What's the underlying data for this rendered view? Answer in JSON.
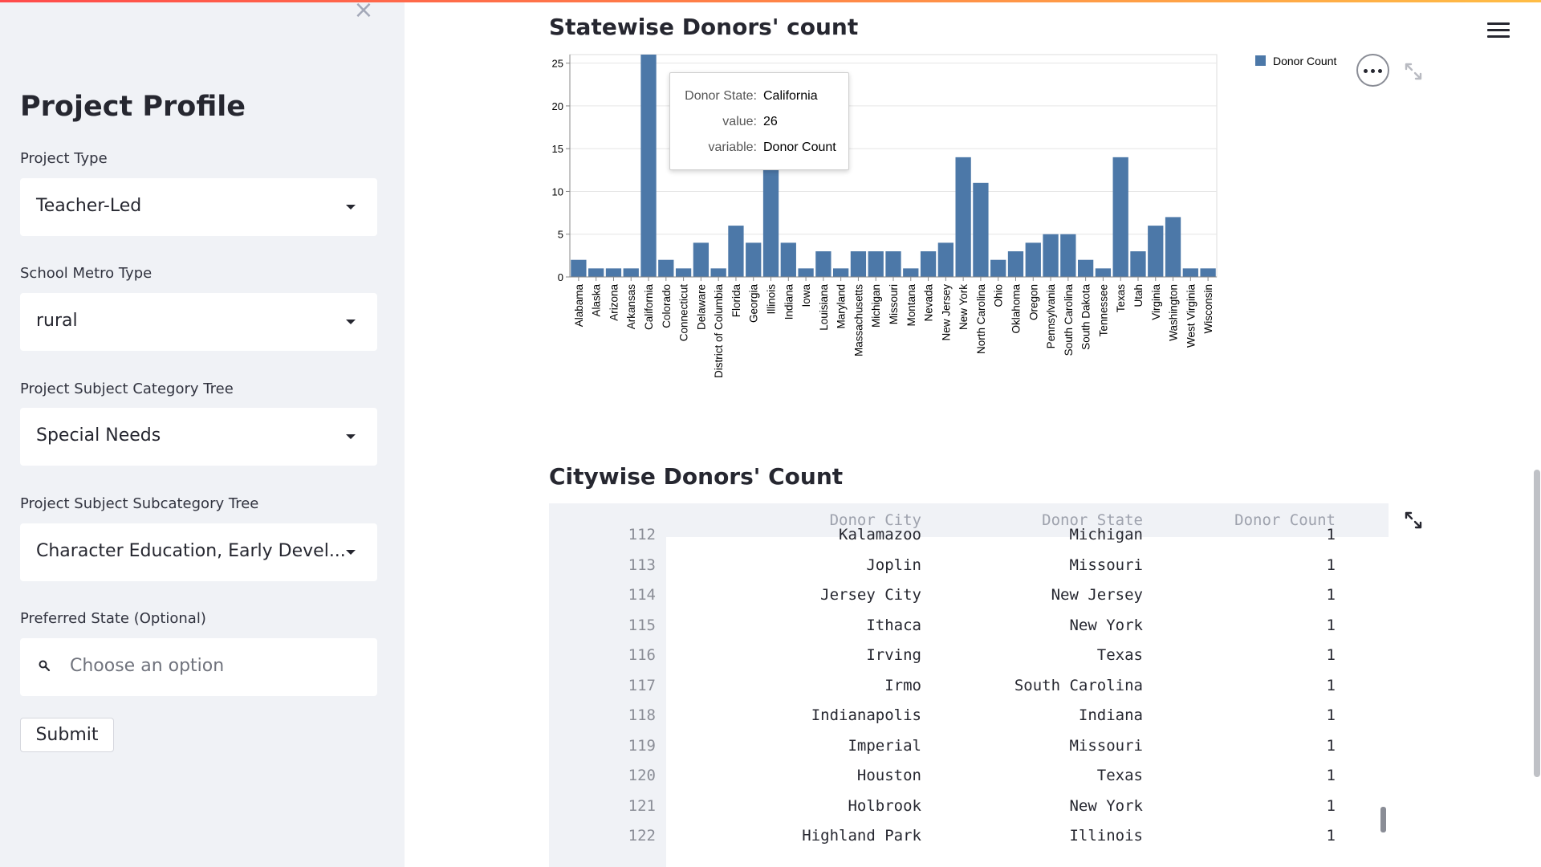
{
  "sidebar": {
    "close_label": "×",
    "title": "Project Profile",
    "fields": [
      {
        "label": "Project Type",
        "value": "Teacher-Led"
      },
      {
        "label": "School Metro Type",
        "value": "rural"
      },
      {
        "label": "Project Subject Category Tree",
        "value": "Special Needs"
      },
      {
        "label": "Project Subject Subcategory Tree",
        "value": "Character Education, Early Devel..."
      },
      {
        "label": "Preferred State (Optional)",
        "placeholder": "Choose an option"
      }
    ],
    "submit_label": "Submit"
  },
  "main": {
    "chart_title": "Statewise Donors' count",
    "table_title": "Citywise Donors' Count"
  },
  "chart_data": {
    "type": "bar",
    "title": "Statewise Donors' count",
    "xlabel": "",
    "ylabel": "",
    "ylim": [
      0,
      26
    ],
    "yticks": [
      0,
      5,
      10,
      15,
      20,
      25
    ],
    "grid": true,
    "legend_position": "top-right",
    "color": "#4c78a8",
    "categories": [
      "Alabama",
      "Alaska",
      "Arizona",
      "Arkansas",
      "California",
      "Colorado",
      "Connecticut",
      "Delaware",
      "District of Columbia",
      "Florida",
      "Georgia",
      "Illinois",
      "Indiana",
      "Iowa",
      "Louisiana",
      "Maryland",
      "Massachusetts",
      "Michigan",
      "Missouri",
      "Montana",
      "Nevada",
      "New Jersey",
      "New York",
      "North Carolina",
      "Ohio",
      "Oklahoma",
      "Oregon",
      "Pennsylvania",
      "South Carolina",
      "South Dakota",
      "Tennessee",
      "Texas",
      "Utah",
      "Virginia",
      "Washington",
      "West Virginia",
      "Wisconsin"
    ],
    "series": [
      {
        "name": "Donor Count",
        "values": [
          2,
          1,
          1,
          1,
          26,
          2,
          1,
          4,
          1,
          6,
          4,
          13,
          4,
          1,
          3,
          1,
          3,
          3,
          3,
          1,
          3,
          4,
          14,
          11,
          2,
          3,
          4,
          5,
          5,
          2,
          1,
          14,
          3,
          6,
          7,
          1,
          1
        ]
      }
    ],
    "tooltip": {
      "rows": [
        {
          "key": "Donor State:",
          "value": "California"
        },
        {
          "key": "value:",
          "value": "26"
        },
        {
          "key": "variable:",
          "value": "Donor Count"
        }
      ]
    }
  },
  "table": {
    "columns": [
      "Donor City",
      "Donor State",
      "Donor Count"
    ],
    "rows": [
      {
        "idx": "112",
        "city": "Kalamazoo",
        "state": "Michigan",
        "count": "1"
      },
      {
        "idx": "113",
        "city": "Joplin",
        "state": "Missouri",
        "count": "1"
      },
      {
        "idx": "114",
        "city": "Jersey City",
        "state": "New Jersey",
        "count": "1"
      },
      {
        "idx": "115",
        "city": "Ithaca",
        "state": "New York",
        "count": "1"
      },
      {
        "idx": "116",
        "city": "Irving",
        "state": "Texas",
        "count": "1"
      },
      {
        "idx": "117",
        "city": "Irmo",
        "state": "South Carolina",
        "count": "1"
      },
      {
        "idx": "118",
        "city": "Indianapolis",
        "state": "Indiana",
        "count": "1"
      },
      {
        "idx": "119",
        "city": "Imperial",
        "state": "Missouri",
        "count": "1"
      },
      {
        "idx": "120",
        "city": "Houston",
        "state": "Texas",
        "count": "1"
      },
      {
        "idx": "121",
        "city": "Holbrook",
        "state": "New York",
        "count": "1"
      },
      {
        "idx": "122",
        "city": "Highland Park",
        "state": "Illinois",
        "count": "1"
      }
    ]
  },
  "colors": {
    "sidebar_bg": "#f0f2f6",
    "bar": "#4c78a8",
    "accent_gradient_start": "#ff4b4b",
    "accent_gradient_end": "#ffbd45"
  },
  "icons": [
    "close-icon",
    "search-icon",
    "chevron-down-icon",
    "hamburger-icon",
    "more-options-icon",
    "fullscreen-icon"
  ]
}
